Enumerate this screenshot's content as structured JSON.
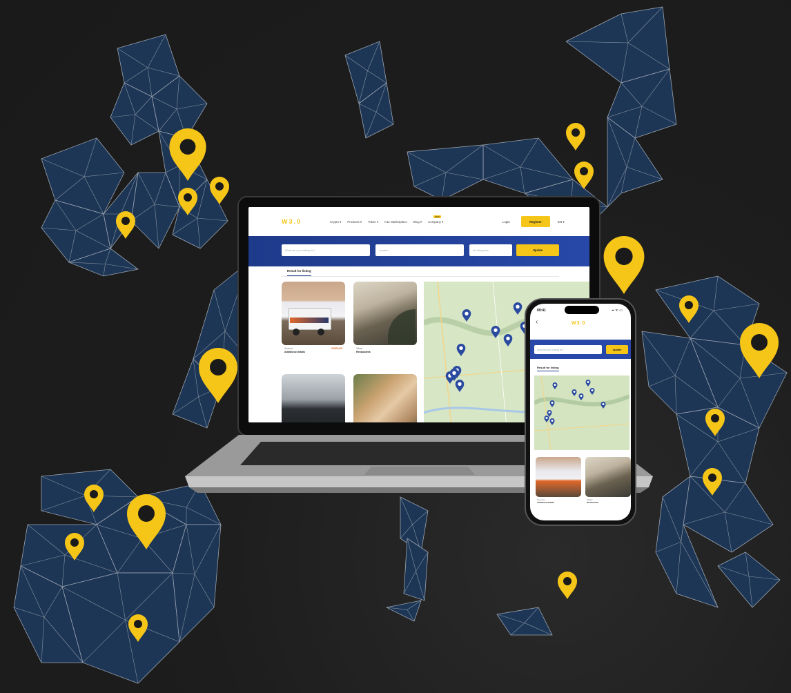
{
  "brand": {
    "accent": "#f5c518",
    "primary": "#1e3a8a",
    "map_line": "#203a5c"
  },
  "background": {
    "icon": "europe-map-pin-icon"
  },
  "laptop": {
    "site": {
      "logo": "W3.0",
      "nav": [
        "Crypto ▾",
        "Products ▾",
        "Token ▾",
        "K11 Marketplace",
        "Blog ▾",
        "Company ▾"
      ],
      "new_badge": "NEW",
      "login": "Login",
      "register": "Register",
      "lang": "EN ▾"
    },
    "search": {
      "query_placeholder": "What are you looking for?",
      "location_placeholder": "Location",
      "category_placeholder": "All categories",
      "update": "Update"
    },
    "result_tab": "Result for listing",
    "cards": [
      {
        "category": "Services",
        "title": "Additional details",
        "logo_text": "STARAXIS"
      },
      {
        "category": "Tables",
        "title": "Restaurants"
      },
      {
        "category": "",
        "title": ""
      },
      {
        "category": "",
        "title": ""
      }
    ]
  },
  "phone": {
    "time": "09:41",
    "signal": "▪▪ ᯤ ▭",
    "logo": "W3.0",
    "search_placeholder": "What are you looking for?",
    "update": "Update",
    "result_tab": "Result for listing",
    "cards": [
      {
        "category": "Services",
        "title": "Additional details"
      },
      {
        "category": "Tables",
        "title": "Restaurants"
      }
    ]
  }
}
